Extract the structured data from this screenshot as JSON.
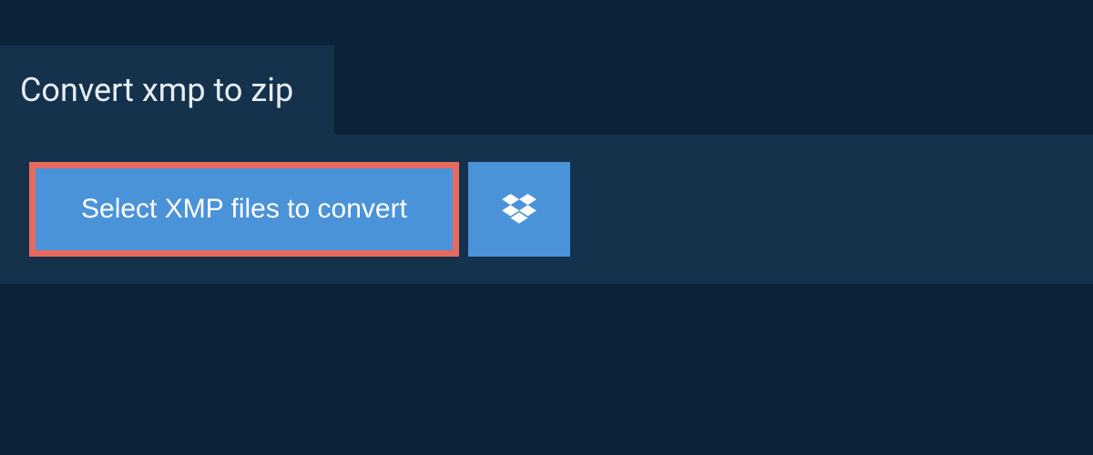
{
  "header": {
    "title": "Convert xmp to zip"
  },
  "actions": {
    "select_label": "Select XMP files to convert",
    "dropbox_icon": "dropbox-icon"
  },
  "colors": {
    "background": "#0d2438",
    "panel": "#15324d",
    "button": "#4b93d8",
    "highlight_border": "#e86a5e",
    "text_light": "#e8eef4",
    "text_white": "#ffffff"
  }
}
